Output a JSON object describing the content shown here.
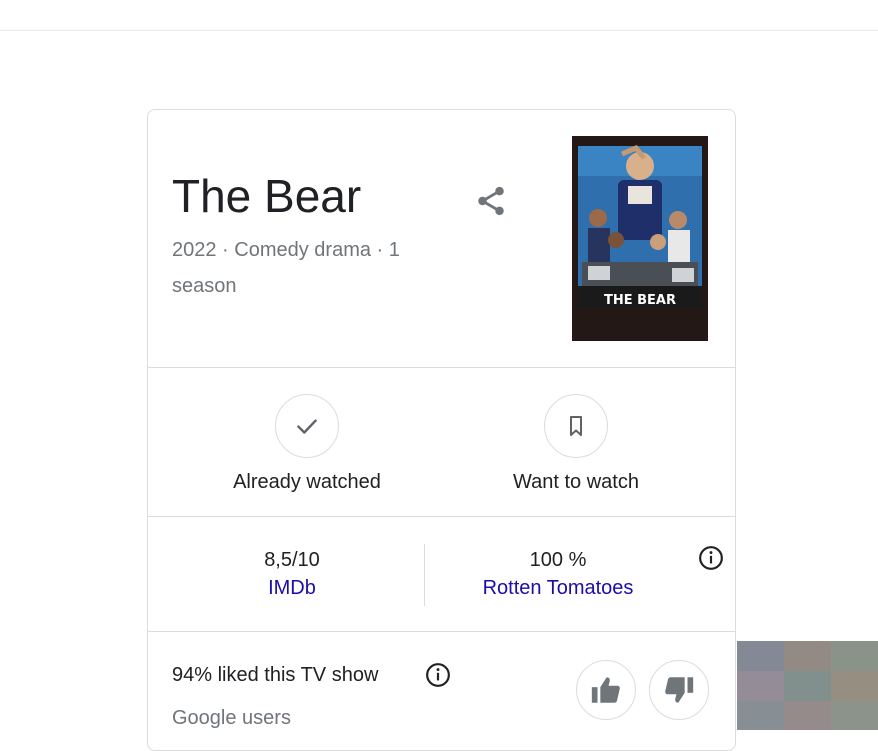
{
  "show": {
    "title": "The Bear",
    "subtitle": "2022 · Comedy drama · 1 season",
    "poster_caption": "THE BEAR"
  },
  "actions": {
    "already_watched": "Already watched",
    "want_to_watch": "Want to watch"
  },
  "ratings": [
    {
      "value": "8,5/10",
      "source": "IMDb"
    },
    {
      "value": "100 %",
      "source": "Rotten Tomatoes"
    }
  ],
  "audience": {
    "liked_text": "94% liked this TV show",
    "source": "Google users"
  },
  "icons": {
    "share": "share-icon",
    "check": "check-icon",
    "bookmark": "bookmark-icon",
    "info": "info-icon",
    "thumbs_up": "thumbs-up-icon",
    "thumbs_down": "thumbs-down-icon"
  },
  "colors": {
    "link": "#1a0dab",
    "secondary_text": "#70757a",
    "border": "#dadce0",
    "icon_gray": "#70757a"
  }
}
